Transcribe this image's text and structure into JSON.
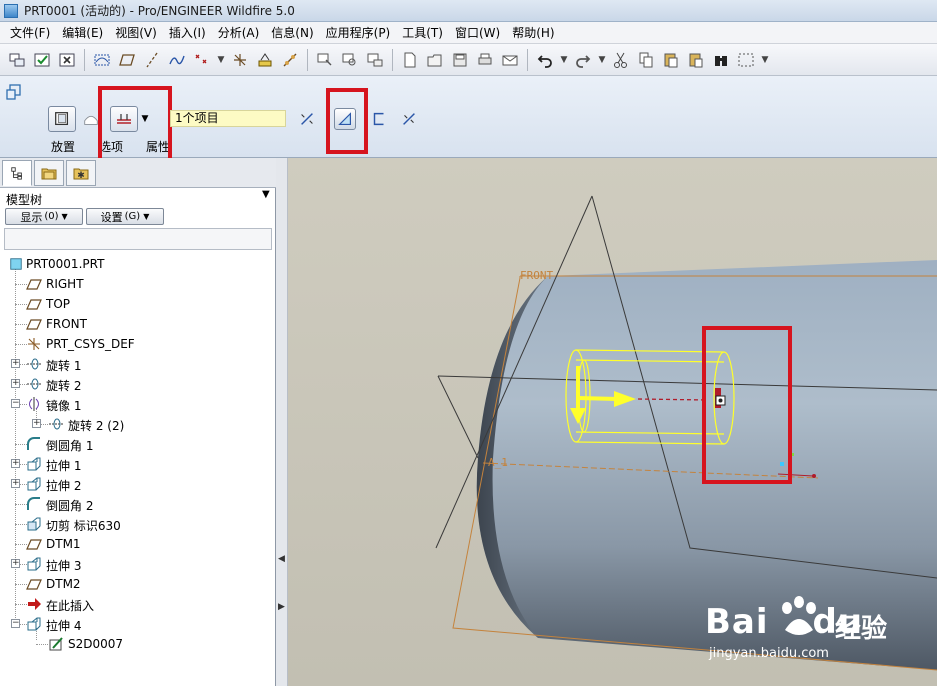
{
  "window": {
    "title": "PRT0001 (活动的) - Pro/ENGINEER Wildfire 5.0"
  },
  "menu": [
    "文件(F)",
    "编辑(E)",
    "视图(V)",
    "插入(I)",
    "分析(A)",
    "信息(N)",
    "应用程序(P)",
    "工具(T)",
    "窗口(W)",
    "帮助(H)"
  ],
  "dashboard": {
    "tabs": [
      "放置",
      "选项",
      "属性"
    ],
    "collector_value": "1个项目"
  },
  "model_tree": {
    "title": "模型树",
    "show_button": "显示",
    "show_shortcut": "(0)",
    "settings_button": "设置",
    "settings_shortcut": "(G)",
    "items": [
      {
        "label": "PRT0001.PRT",
        "icon": "part-icon",
        "level": 0,
        "expandable": false
      },
      {
        "label": "RIGHT",
        "icon": "datum-plane-icon",
        "level": 1,
        "expandable": false
      },
      {
        "label": "TOP",
        "icon": "datum-plane-icon",
        "level": 1,
        "expandable": false
      },
      {
        "label": "FRONT",
        "icon": "datum-plane-icon",
        "level": 1,
        "expandable": false
      },
      {
        "label": "PRT_CSYS_DEF",
        "icon": "csys-icon",
        "level": 1,
        "expandable": false
      },
      {
        "label": "旋转 1",
        "icon": "revolve-icon",
        "level": 1,
        "expandable": true
      },
      {
        "label": "旋转 2",
        "icon": "revolve-icon",
        "level": 1,
        "expandable": true
      },
      {
        "label": "镜像 1",
        "icon": "mirror-icon",
        "level": 1,
        "expandable": true
      },
      {
        "label": "旋转 2 (2)",
        "icon": "revolve-icon",
        "level": 2,
        "expandable": true
      },
      {
        "label": "倒圆角 1",
        "icon": "round-icon",
        "level": 1,
        "expandable": false
      },
      {
        "label": "拉伸 1",
        "icon": "extrude-icon",
        "level": 1,
        "expandable": true
      },
      {
        "label": "拉伸 2",
        "icon": "extrude-icon",
        "level": 1,
        "expandable": true
      },
      {
        "label": "倒圆角 2",
        "icon": "round-icon",
        "level": 1,
        "expandable": false
      },
      {
        "label": "切剪 标识630",
        "icon": "cut-icon",
        "level": 1,
        "expandable": false
      },
      {
        "label": "DTM1",
        "icon": "datum-plane-icon",
        "level": 1,
        "expandable": false
      },
      {
        "label": "拉伸 3",
        "icon": "extrude-icon",
        "level": 1,
        "expandable": true
      },
      {
        "label": "DTM2",
        "icon": "datum-plane-icon",
        "level": 1,
        "expandable": false
      },
      {
        "label": "在此插入",
        "icon": "insert-here-arrow-icon",
        "level": 1,
        "expandable": false
      },
      {
        "label": "拉伸 4",
        "icon": "extrude-icon",
        "level": 1,
        "expandable": true
      },
      {
        "label": "S2D0007",
        "icon": "sketch-icon",
        "level": 2,
        "expandable": false
      }
    ]
  },
  "graphics": {
    "datum_front_label": "FRONT",
    "axis_label": "A_1",
    "watermark_brand": "Bai",
    "watermark_brand_tail": "du",
    "watermark_cn": "经验",
    "watermark_url": "jingyan.baidu.com"
  },
  "colors": {
    "highlight_red": "#d6141e",
    "preview_yellow": "#ffff2a",
    "datum_orange": "#c4833d",
    "cylinder_blue": "#9ba8b6"
  }
}
